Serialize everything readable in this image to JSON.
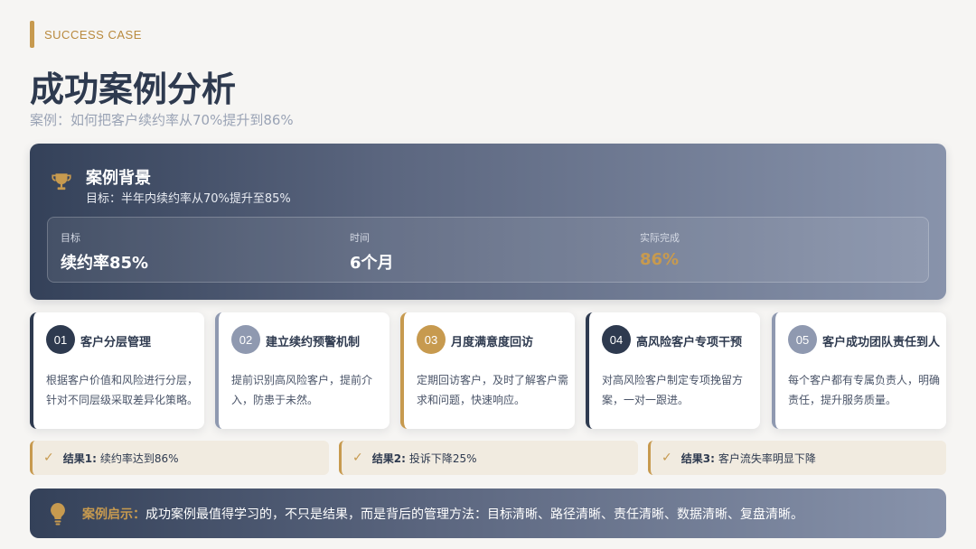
{
  "header": {
    "tag": "SUCCESS CASE",
    "title": "成功案例分析",
    "subtitle": "案例：如何把客户续约率从70%提升到86%"
  },
  "hero": {
    "icon": "trophy-icon",
    "title": "案例背景",
    "subtitle": "目标：半年内续约率从70%提升至85%",
    "stats": [
      {
        "label": "目标",
        "value": "续约率85%"
      },
      {
        "label": "时间",
        "value": "6个月"
      },
      {
        "label": "实际完成",
        "value": "86%"
      }
    ]
  },
  "steps": [
    {
      "num": "01",
      "title": "客户分层管理",
      "desc": "根据客户价值和风险进行分层，针对不同层级采取差异化策略。",
      "color": "#2e3a4f"
    },
    {
      "num": "02",
      "title": "建立续约预警机制",
      "desc": "提前识别高风险客户，提前介入，防患于未然。",
      "color": "#8f99b0"
    },
    {
      "num": "03",
      "title": "月度满意度回访",
      "desc": "定期回访客户，及时了解客户需求和问题，快速响应。",
      "color": "#c79a4f"
    },
    {
      "num": "04",
      "title": "高风险客户专项干预",
      "desc": "对高风险客户制定专项挽留方案，一对一跟进。",
      "color": "#2e3a4f"
    },
    {
      "num": "05",
      "title": "客户成功团队责任到人",
      "desc": "每个客户都有专属负责人，明确责任，提升服务质量。",
      "color": "#8f99b0"
    }
  ],
  "results": [
    {
      "label": "结果1:",
      "text": "续约率达到86%"
    },
    {
      "label": "结果2:",
      "text": "投诉下降25%"
    },
    {
      "label": "结果3:",
      "text": "客户流失率明显下降"
    }
  ],
  "insight": {
    "icon": "lightbulb-icon",
    "label": "案例启示：",
    "text": "成功案例最值得学习的，不只是结果，而是背后的管理方法：目标清晰、路径清晰、责任清晰、数据清晰、复盘清晰。"
  },
  "colors": {
    "accent_gold": "#c79a4f",
    "navy": "#2e3a4f"
  }
}
